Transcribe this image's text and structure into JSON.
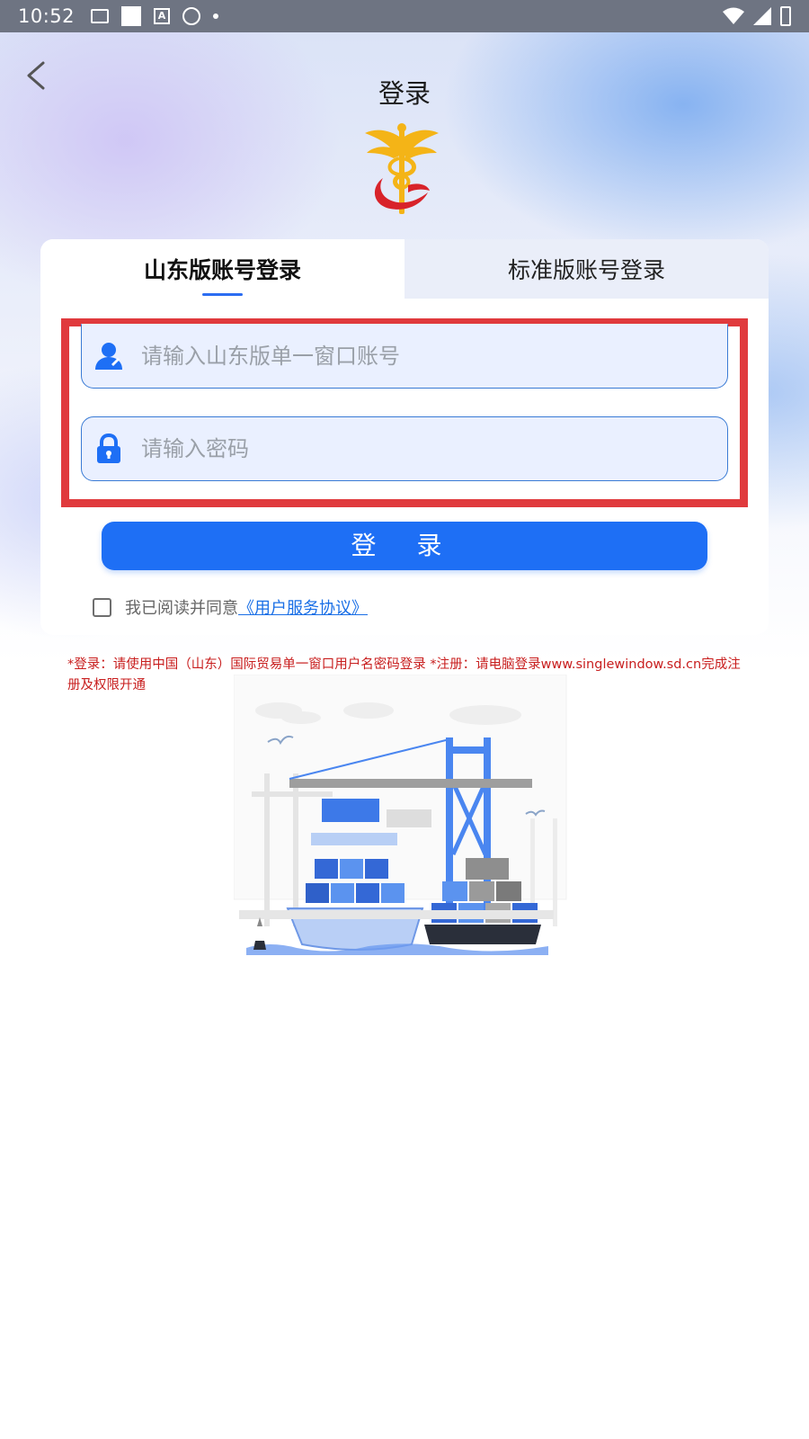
{
  "status_bar": {
    "time": "10:52",
    "icons_left": [
      "image-icon",
      "square-icon",
      "font-a-icon",
      "globe-icon",
      "dot-icon"
    ],
    "icons_right": [
      "wifi-icon",
      "signal-icon",
      "battery-charging-icon"
    ]
  },
  "nav": {
    "title": "登录",
    "back_icon": "chevron-left-icon"
  },
  "tabs": [
    {
      "label": "山东版账号登录",
      "active": true
    },
    {
      "label": "标准版账号登录",
      "active": false
    }
  ],
  "form": {
    "username_placeholder": "请输入山东版单一窗口账号",
    "password_placeholder": "请输入密码",
    "username_icon": "user-icon",
    "password_icon": "lock-icon",
    "login_label": "登 录",
    "agree_text": "我已阅读并同意",
    "agree_link": "《用户服务协议》",
    "agree_checked": false
  },
  "notice": "*登录：请使用中国（山东）国际贸易单一窗口用户名密码登录 *注册：请电脑登录www.singlewindow.sd.cn完成注册及权限开通",
  "colors": {
    "accent": "#1e6ff5",
    "highlight": "#e03a3d",
    "notice": "#c81e1e",
    "input_bg": "#eaf0ff"
  }
}
